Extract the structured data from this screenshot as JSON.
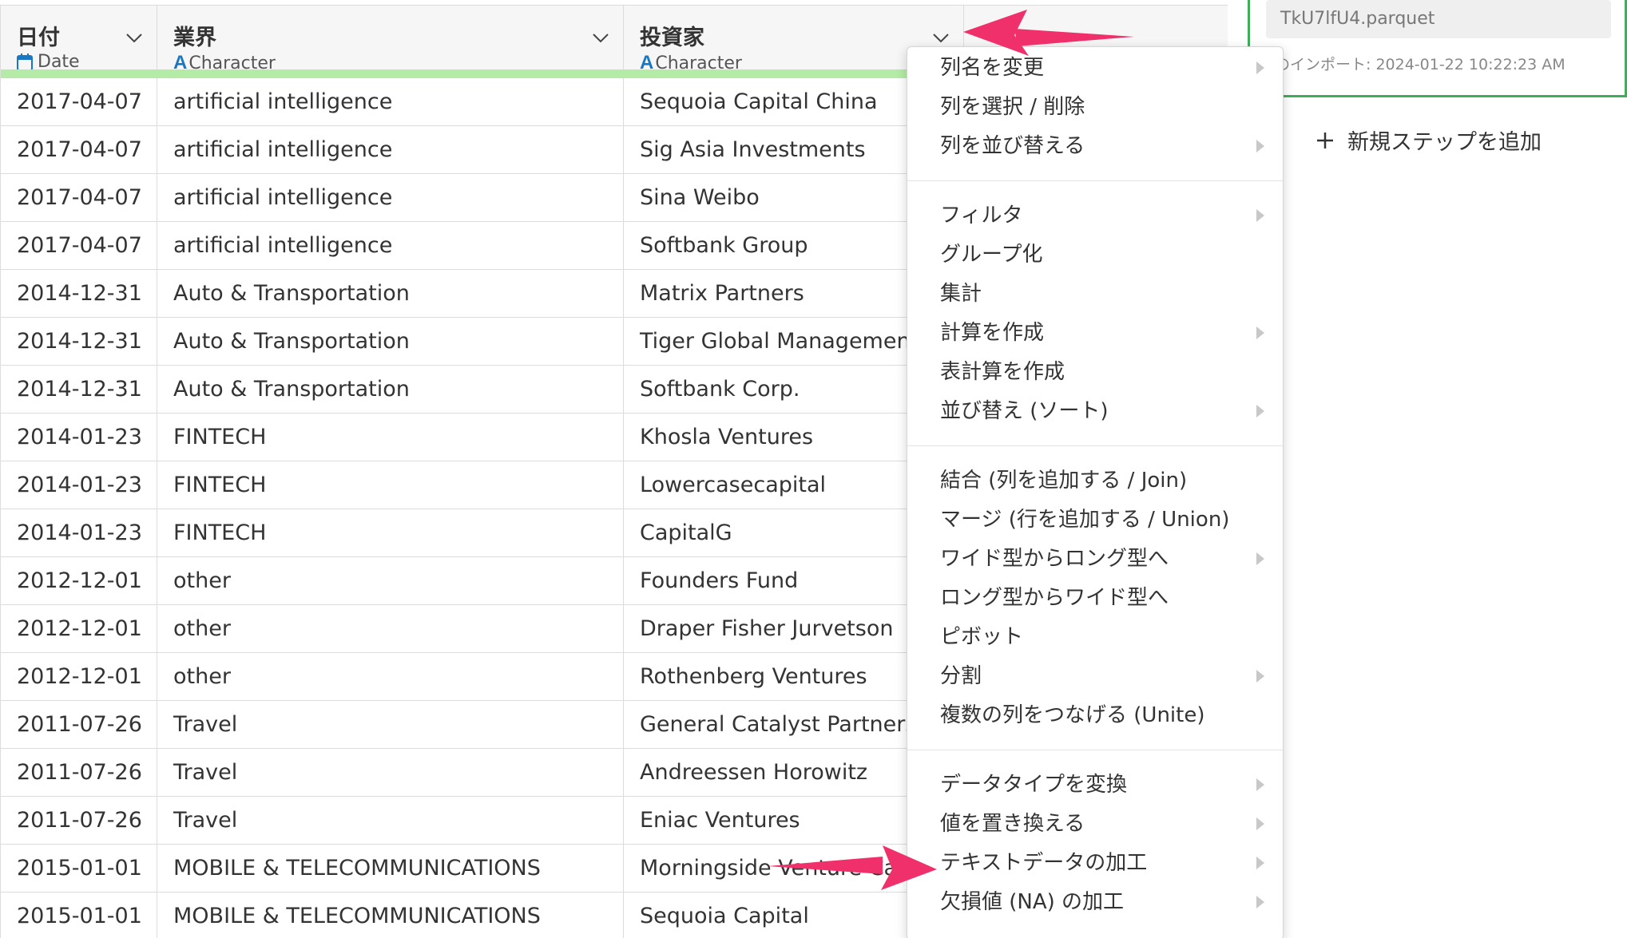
{
  "columns": [
    {
      "name": "日付",
      "type": "Date",
      "type_icon": "calendar-icon"
    },
    {
      "name": "業界",
      "type": "Character",
      "type_icon": "A"
    },
    {
      "name": "投資家",
      "type": "Character",
      "type_icon": "A"
    }
  ],
  "rows": [
    [
      "2017-04-07",
      "artificial intelligence",
      "Sequoia Capital China"
    ],
    [
      "2017-04-07",
      "artificial intelligence",
      "Sig Asia Investments"
    ],
    [
      "2017-04-07",
      "artificial intelligence",
      "Sina Weibo"
    ],
    [
      "2017-04-07",
      "artificial intelligence",
      "Softbank Group"
    ],
    [
      "2014-12-31",
      "Auto & Transportation",
      "Matrix Partners"
    ],
    [
      "2014-12-31",
      "Auto & Transportation",
      "Tiger   Global Management"
    ],
    [
      "2014-12-31",
      "Auto & Transportation",
      "Softbank Corp."
    ],
    [
      "2014-01-23",
      "FINTECH",
      "Khosla Ventures"
    ],
    [
      "2014-01-23",
      "FINTECH",
      "Lowercasecapital"
    ],
    [
      "2014-01-23",
      "FINTECH",
      "CapitalG"
    ],
    [
      "2012-12-01",
      "other",
      "Founders Fund"
    ],
    [
      "2012-12-01",
      "other",
      "Draper   Fisher Jurvetson"
    ],
    [
      "2012-12-01",
      "other",
      "Rothenberg Ventures"
    ],
    [
      "2011-07-26",
      "Travel",
      "General Catalyst Partners"
    ],
    [
      "2011-07-26",
      "Travel",
      "Andreessen Horowitz"
    ],
    [
      "2011-07-26",
      "Travel",
      "Eniac Ventures"
    ],
    [
      "2015-01-01",
      "MOBILE & TELECOMMUNICATIONS",
      "Morningside Venture Capital"
    ],
    [
      "2015-01-01",
      "MOBILE & TELECOMMUNICATIONS",
      "Sequoia Capital"
    ]
  ],
  "right_panel": {
    "file_name": "TkU7lfU4.parquet",
    "last_import": "回のインポート: 2024-01-22 10:22:23 AM",
    "add_step_label": "新規ステップを追加"
  },
  "menu": {
    "items": [
      {
        "label": "列名を変更",
        "submenu": true
      },
      {
        "label": "列を選択 / 削除",
        "submenu": false
      },
      {
        "label": "列を並び替える",
        "submenu": true
      },
      {
        "label": "フィルタ",
        "submenu": true
      },
      {
        "label": "グループ化",
        "submenu": false
      },
      {
        "label": "集計",
        "submenu": false
      },
      {
        "label": "計算を作成",
        "submenu": true
      },
      {
        "label": "表計算を作成",
        "submenu": false
      },
      {
        "label": "並び替え (ソート)",
        "submenu": true
      },
      {
        "label": "結合 (列を追加する / Join)",
        "submenu": false
      },
      {
        "label": "マージ (行を追加する / Union)",
        "submenu": false
      },
      {
        "label": "ワイド型からロング型へ",
        "submenu": true
      },
      {
        "label": "ロング型からワイド型へ",
        "submenu": false
      },
      {
        "label": "ピボット",
        "submenu": false
      },
      {
        "label": "分割",
        "submenu": true
      },
      {
        "label": "複数の列をつなげる (Unite)",
        "submenu": false
      },
      {
        "label": "データタイプを変換",
        "submenu": true
      },
      {
        "label": "値を置き換える",
        "submenu": true
      },
      {
        "label": "テキストデータの加工",
        "submenu": true
      },
      {
        "label": "欠損値 (NA) の加工",
        "submenu": true
      }
    ]
  },
  "colors": {
    "accent_green": "#3fae5a",
    "header_bar": "#b4eca7",
    "annotation_arrow": "#f0306a",
    "type_icon_blue": "#1a78c2"
  }
}
